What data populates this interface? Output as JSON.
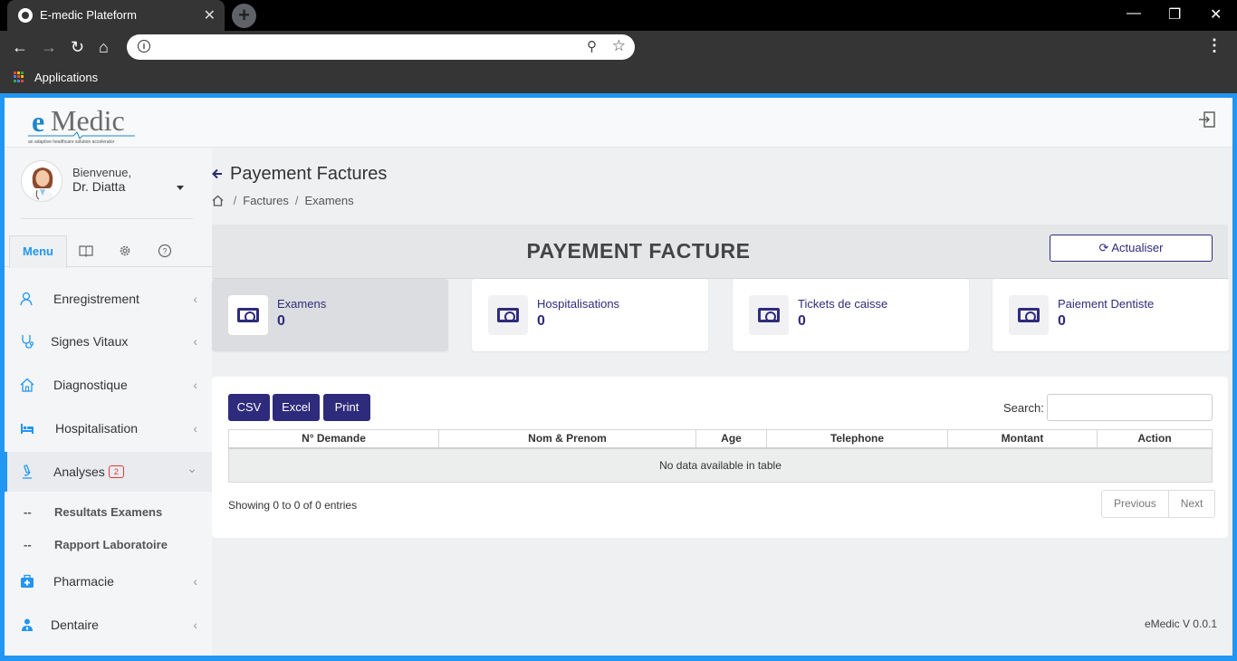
{
  "browser": {
    "tab_title": "E-medic Plateform",
    "tab_close": "✕",
    "new_tab": "+",
    "win_min": "—",
    "win_max": "❐",
    "win_close": "✕",
    "back": "←",
    "forward": "→",
    "reload": "↻",
    "home": "⌂",
    "url": "",
    "info_glyph": "i",
    "zoom_glyph": "⚲",
    "star_glyph": "☆",
    "menu_glyph": "⋮",
    "bookmarks_apps": "Applications"
  },
  "app": {
    "logo_e": "e",
    "logo_medic": "Medic",
    "logo_tagline": "an adaptive healthcare solution accelerator",
    "user": {
      "greeting": "Bienvenue,",
      "name": "Dr. Diatta"
    },
    "sidebar_tabs": {
      "menu": "Menu"
    },
    "nav": [
      {
        "label": "Enregistrement",
        "icon": "user-icon"
      },
      {
        "label": "Signes Vitaux",
        "icon": "stethoscope-icon"
      },
      {
        "label": "Diagnostique",
        "icon": "home-icon"
      },
      {
        "label": "Hospitalisation",
        "icon": "bed-icon"
      },
      {
        "label": "Analyses",
        "icon": "microscope-icon",
        "badge": "2"
      },
      {
        "label": "Pharmacie",
        "icon": "medkit-icon"
      },
      {
        "label": "Dentaire",
        "icon": "doctor-icon"
      }
    ],
    "subnav": [
      "Resultats Examens",
      "Rapport Laboratoire"
    ],
    "subnav_dash": "--",
    "chevron_left": "‹",
    "chevron_down": "⌄"
  },
  "page": {
    "title": "Payement Factures",
    "back_glyph": "🡐",
    "breadcrumb": [
      "Factures",
      "Examens"
    ],
    "breadcrumb_sep": "/",
    "banner_title": "PAYEMENT FACTURE",
    "refresh_label": "Actualiser",
    "refresh_glyph": "⟳",
    "cards": [
      {
        "label": "Examens",
        "value": "0"
      },
      {
        "label": "Hospitalisations",
        "value": "0"
      },
      {
        "label": "Tickets de caisse",
        "value": "0"
      },
      {
        "label": "Paiement Dentiste",
        "value": "0"
      }
    ],
    "export_buttons": [
      "CSV",
      "Excel",
      "Print"
    ],
    "search_label": "Search:",
    "table": {
      "columns": [
        "N° Demande",
        "Nom & Prenom",
        "Age",
        "Telephone",
        "Montant",
        "Action"
      ],
      "empty": "No data available in table"
    },
    "info": "Showing 0 to 0 of 0 entries",
    "pager": {
      "previous": "Previous",
      "next": "Next"
    },
    "version": "eMedic V 0.0.1"
  },
  "colors": {
    "primary": "#2f2b7c",
    "accent": "#2196f3",
    "badge": "#e53935"
  }
}
